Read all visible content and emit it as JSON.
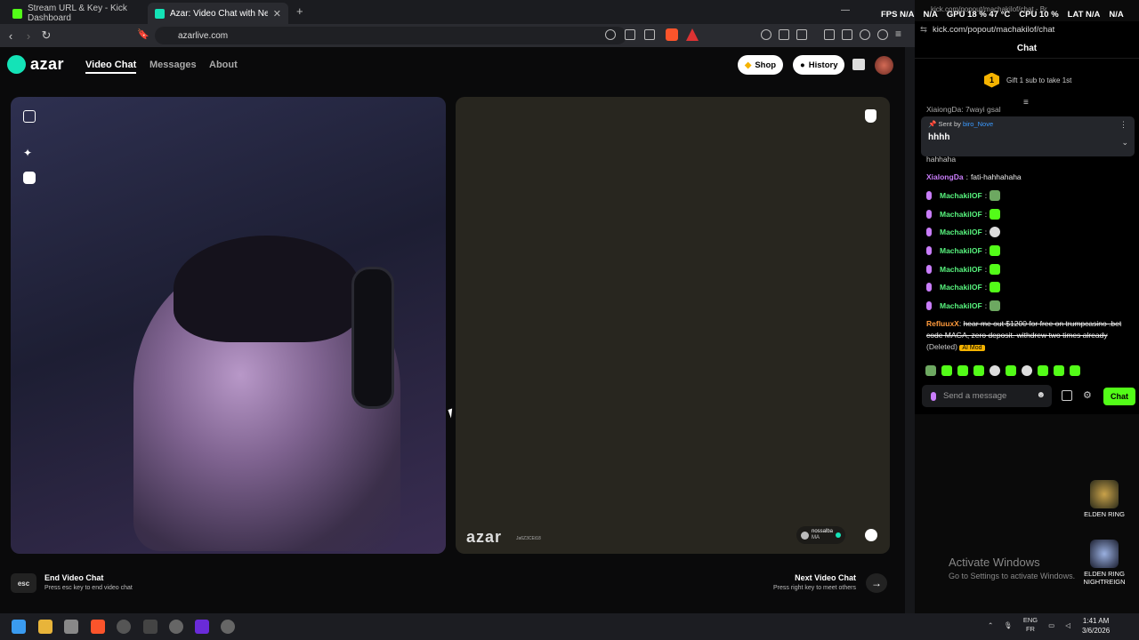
{
  "browser": {
    "tabs": [
      {
        "label": "Stream URL & Key - Kick Dashboard"
      },
      {
        "label": "Azar: Video Chat with New Pe"
      }
    ],
    "url": "azarlive.com"
  },
  "site": {
    "logo": "azar",
    "nav": [
      "Video Chat",
      "Messages",
      "About"
    ],
    "shop_label": "Shop",
    "history_label": "History",
    "watermark": "azar",
    "watermark_code": "Ja6Z3CEt18",
    "partner": {
      "name": "nossalba",
      "country": "MA"
    },
    "end": {
      "key": "esc",
      "title": "End Video Chat",
      "subtitle": "Press esc key to end video chat"
    },
    "next": {
      "title": "Next Video Chat",
      "subtitle": "Press right key to meet others",
      "arrow": "→"
    }
  },
  "hud": {
    "fps_label": "FPS",
    "fps": "N/A",
    "na2": "N/A",
    "gpu_label": "GPU",
    "gpu": "18 % 47 °C",
    "cpu_label": "CPU",
    "cpu": "10 %",
    "lat_label": "LAT",
    "lat": "N/A",
    "na3": "N/A"
  },
  "chat": {
    "window_title": "kick.com/popout/machakilof/chat - Br",
    "url": "kick.com/popout/machakilof/chat",
    "header": "Chat",
    "gift_badge": "1",
    "gift_text": "Gift 1 sub to take 1st",
    "partial_top": "XiaiongDa: 7wayi gsal",
    "pinned": {
      "sent_by": "Sent by",
      "user": "biro_Nove",
      "text": "hhhh"
    },
    "partial_after": "hahhaha",
    "messages": [
      {
        "user": "XialongDa",
        "text": "fati-hahhahaha"
      },
      {
        "user": "MachakilOF",
        "text": ""
      },
      {
        "user": "MachakilOF",
        "text": ""
      },
      {
        "user": "MachakilOF",
        "text": ""
      },
      {
        "user": "MachakilOF",
        "text": ""
      },
      {
        "user": "MachakilOF",
        "text": ""
      },
      {
        "user": "MachakilOF",
        "text": ""
      },
      {
        "user": "MachakilOF",
        "text": ""
      }
    ],
    "deleted": {
      "user": "RefluuxX",
      "text": "hear me out $1200 for free on trumpcasino .bet code MAGA, zero deposit. withdrew two times already",
      "deleted_label": "(Deleted)",
      "mod_label": "AI Mod"
    },
    "input_placeholder": "Send a message",
    "send_label": "Chat"
  },
  "desktop": {
    "icons": [
      "ELDEN RING",
      "ELDEN RING NIGHTREIGN"
    ],
    "activate_title": "Activate Windows",
    "activate_sub": "Go to Settings to activate Windows."
  },
  "taskbar": {
    "lang": "ENG",
    "region": "FR",
    "time": "1:41 AM",
    "date": "3/6/2026"
  }
}
